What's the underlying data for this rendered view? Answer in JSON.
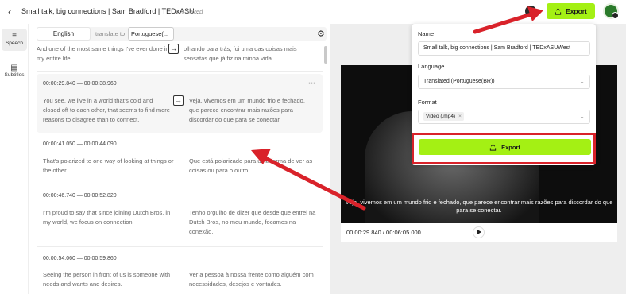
{
  "header": {
    "back_icon": "chevron-left-icon",
    "title": "Small talk, big connections | Sam Bradford | TEDxASU...",
    "saved": "Saved",
    "export_label": "Export"
  },
  "nav": {
    "items": [
      {
        "label": "Speech",
        "icon": "waveform-icon"
      },
      {
        "label": "Subtitles",
        "icon": "subtitles-icon"
      }
    ]
  },
  "editor": {
    "source_lang": "English",
    "translate_to_label": "translate to",
    "target_lang": "Portuguese(...",
    "segments": [
      {
        "time": "",
        "src": "And one of the most same things I've ever done in my entire life.",
        "dst": "olhando para trás, foi uma das coisas mais sensatas que já fiz na minha vida."
      },
      {
        "time": "00:00:29.840  —  00:00:38.960",
        "src": "You see, we live in a world that's cold and closed off to each other, that seems to find more reasons to disagree than to connect.",
        "dst": "Veja, vivemos em um mundo frio e fechado, que parece encontrar mais razões para discordar do que para se conectar."
      },
      {
        "time": "00:00:41.050  —  00:00:44.090",
        "src": "That's polarized to one way of looking at things or the other.",
        "dst": "Que está polarizado para uma forma de ver as coisas ou para o outro."
      },
      {
        "time": "00:00:46.740  —  00:00:52.820",
        "src": "I'm proud to say that since joining Dutch Bros, in my world, we focus on connection.",
        "dst": "Tenho orgulho de dizer que desde que entrei na Dutch Bros, no meu mundo, focamos na conexão."
      },
      {
        "time": "00:00:54.060  —  00:00:59.860",
        "src": "Seeing the person in front of us is someone with needs and wants and desires.",
        "dst": "Ver a pessoa à nossa frente como alguém com necessidades, desejos e vontades."
      }
    ]
  },
  "preview": {
    "caption": "Veja, vivemos em um mundo frio e fechado, que parece encontrar mais razões para discordar do que para se conectar.",
    "timecode": "00:00:29.840 / 00:06:05.000"
  },
  "export_panel": {
    "name_label": "Name",
    "name_value": "Small talk, big connections | Sam Bradford | TEDxASUWest",
    "language_label": "Language",
    "language_value": "Translated (Portuguese(BR))",
    "format_label": "Format",
    "format_value": "Video (.mp4)",
    "export_label": "Export"
  },
  "colors": {
    "accent": "#a4f014",
    "annotation": "#d9222a"
  }
}
